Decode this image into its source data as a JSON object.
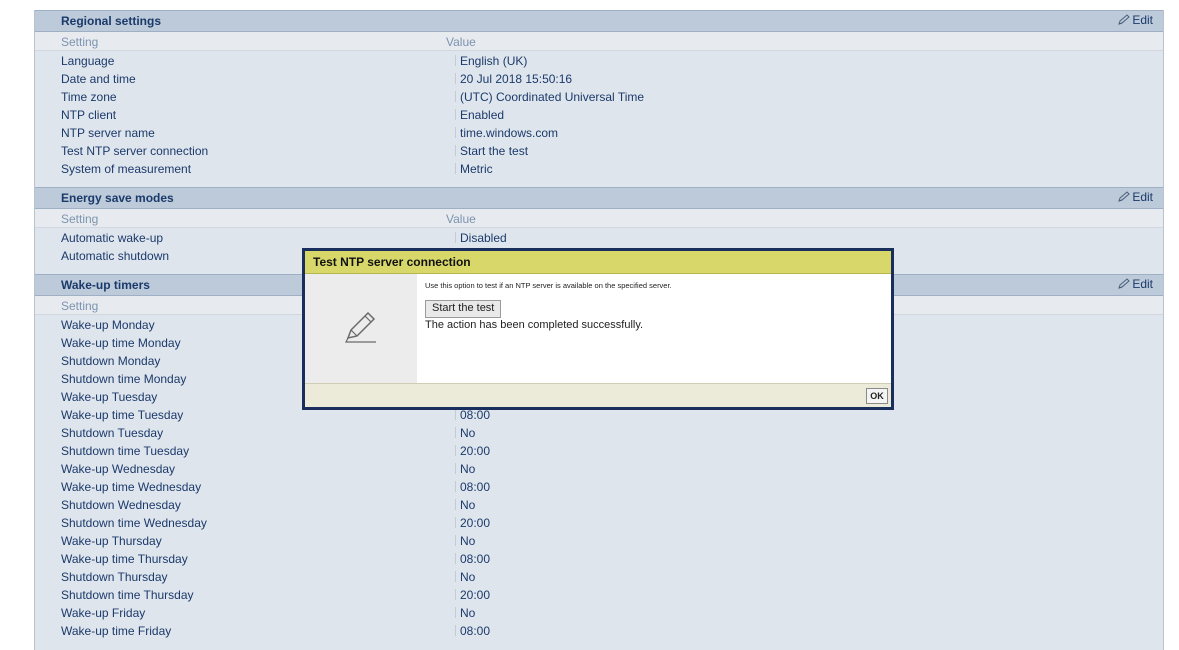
{
  "sections": {
    "regional": {
      "title": "Regional settings",
      "edit_label": "Edit",
      "col_setting": "Setting",
      "col_value": "Value",
      "rows": [
        {
          "label": "Language",
          "value": "English (UK)"
        },
        {
          "label": "Date and time",
          "value": "20 Jul 2018 15:50:16"
        },
        {
          "label": "Time zone",
          "value": "(UTC) Coordinated Universal Time"
        },
        {
          "label": "NTP client",
          "value": "Enabled"
        },
        {
          "label": "NTP server name",
          "value": "time.windows.com"
        },
        {
          "label": "Test NTP server connection",
          "value": "Start the test"
        },
        {
          "label": "System of measurement",
          "value": "Metric"
        }
      ]
    },
    "energy": {
      "title": "Energy save modes",
      "edit_label": "Edit",
      "col_setting": "Setting",
      "col_value": "Value",
      "rows": [
        {
          "label": "Automatic wake-up",
          "value": "Disabled"
        },
        {
          "label": "Automatic shutdown",
          "value": ""
        }
      ]
    },
    "wakeup": {
      "title": "Wake-up timers",
      "edit_label": "Edit",
      "col_setting": "Setting",
      "rows": [
        {
          "label": "Wake-up Monday",
          "value": ""
        },
        {
          "label": "Wake-up time Monday",
          "value": ""
        },
        {
          "label": "Shutdown Monday",
          "value": ""
        },
        {
          "label": "Shutdown time Monday",
          "value": ""
        },
        {
          "label": "Wake-up Tuesday",
          "value": ""
        },
        {
          "label": "Wake-up time Tuesday",
          "value": "08:00"
        },
        {
          "label": "Shutdown Tuesday",
          "value": "No"
        },
        {
          "label": "Shutdown time Tuesday",
          "value": "20:00"
        },
        {
          "label": "Wake-up Wednesday",
          "value": "No"
        },
        {
          "label": "Wake-up time Wednesday",
          "value": "08:00"
        },
        {
          "label": "Shutdown Wednesday",
          "value": "No"
        },
        {
          "label": "Shutdown time Wednesday",
          "value": "20:00"
        },
        {
          "label": "Wake-up Thursday",
          "value": "No"
        },
        {
          "label": "Wake-up time Thursday",
          "value": "08:00"
        },
        {
          "label": "Shutdown Thursday",
          "value": "No"
        },
        {
          "label": "Shutdown time Thursday",
          "value": "20:00"
        },
        {
          "label": "Wake-up Friday",
          "value": "No"
        },
        {
          "label": "Wake-up time Friday",
          "value": "08:00"
        }
      ]
    }
  },
  "dialog": {
    "title": "Test NTP server connection",
    "description": "Use this option to test if an NTP server is available on the specified server.",
    "button_label": "Start the test",
    "result": "The action has been completed successfully.",
    "ok_label": "OK",
    "icon": "pencil-icon"
  },
  "icons": {
    "edit": "pencil-icon"
  },
  "colors": {
    "section_header": "#bccad9",
    "panel": "#dfe5ec",
    "text": "#1b3a6b",
    "dialog_title": "#d8d86a",
    "dialog_border": "#1a2e5e"
  }
}
